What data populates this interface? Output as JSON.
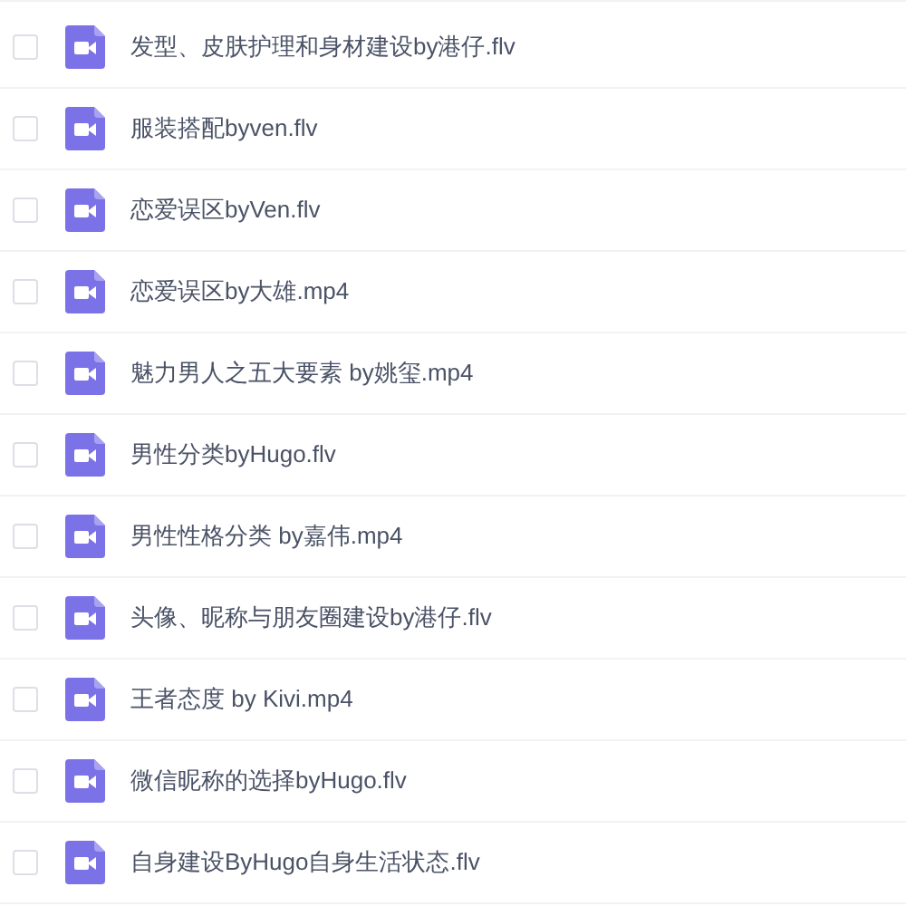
{
  "files": [
    {
      "name": "发型、皮肤护理和身材建设by港仔.flv",
      "checked": false
    },
    {
      "name": "服装搭配byven.flv",
      "checked": false
    },
    {
      "name": "恋爱误区byVen.flv",
      "checked": false
    },
    {
      "name": "恋爱误区by大雄.mp4",
      "checked": false
    },
    {
      "name": "魅力男人之五大要素 by姚玺.mp4",
      "checked": false
    },
    {
      "name": "男性分类byHugo.flv",
      "checked": false
    },
    {
      "name": "男性性格分类 by嘉伟.mp4",
      "checked": false
    },
    {
      "name": "头像、昵称与朋友圈建设by港仔.flv",
      "checked": false
    },
    {
      "name": "王者态度 by Kivi.mp4",
      "checked": false
    },
    {
      "name": "微信昵称的选择byHugo.flv",
      "checked": false
    },
    {
      "name": "自身建设ByHugo自身生活状态.flv",
      "checked": false
    }
  ]
}
